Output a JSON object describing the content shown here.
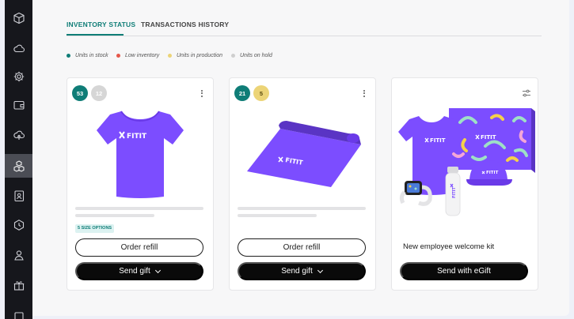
{
  "sidebar": {
    "icons": [
      "cube-icon",
      "cloud-icon",
      "gear-icon",
      "wallet-icon",
      "cloud-upload-icon",
      "boxes-icon",
      "contacts-icon",
      "clock-icon",
      "user-icon",
      "gift-icon"
    ],
    "active_index": 5
  },
  "tabs": [
    {
      "label": "INVENTORY STATUS",
      "active": true
    },
    {
      "label": "TRANSACTIONS HISTORY",
      "active": false
    }
  ],
  "legend": [
    {
      "label": "Units in stock",
      "color": "#0f7d77"
    },
    {
      "label": "Low inventory",
      "color": "#e5574a"
    },
    {
      "label": "Units in production",
      "color": "#ecd477"
    },
    {
      "label": "Units on hold",
      "color": "#cfcfcf"
    }
  ],
  "cards": [
    {
      "product": "tshirt",
      "badges": [
        {
          "value": "53",
          "color": "#0f7d77",
          "text_color": "#ffffff"
        },
        {
          "value": "12",
          "color": "#d6d6d6",
          "text_color": "#ffffff"
        }
      ],
      "size_tag": "5 SIZE OPTIONS",
      "primary_label": "Order refill",
      "secondary_label": "Send gift"
    },
    {
      "product": "yoga-mat",
      "badges": [
        {
          "value": "21",
          "color": "#0f7d77",
          "text_color": "#ffffff"
        },
        {
          "value": "5",
          "color": "#ecd477",
          "text_color": "#5a4a10"
        }
      ],
      "primary_label": "Order refill",
      "secondary_label": "Send gift"
    },
    {
      "product": "welcome-kit",
      "title": "New employee welcome kit",
      "secondary_label": "Send with eGift"
    }
  ],
  "brand": {
    "logo_text": "FITIT",
    "product_color": "#7c4dff"
  }
}
